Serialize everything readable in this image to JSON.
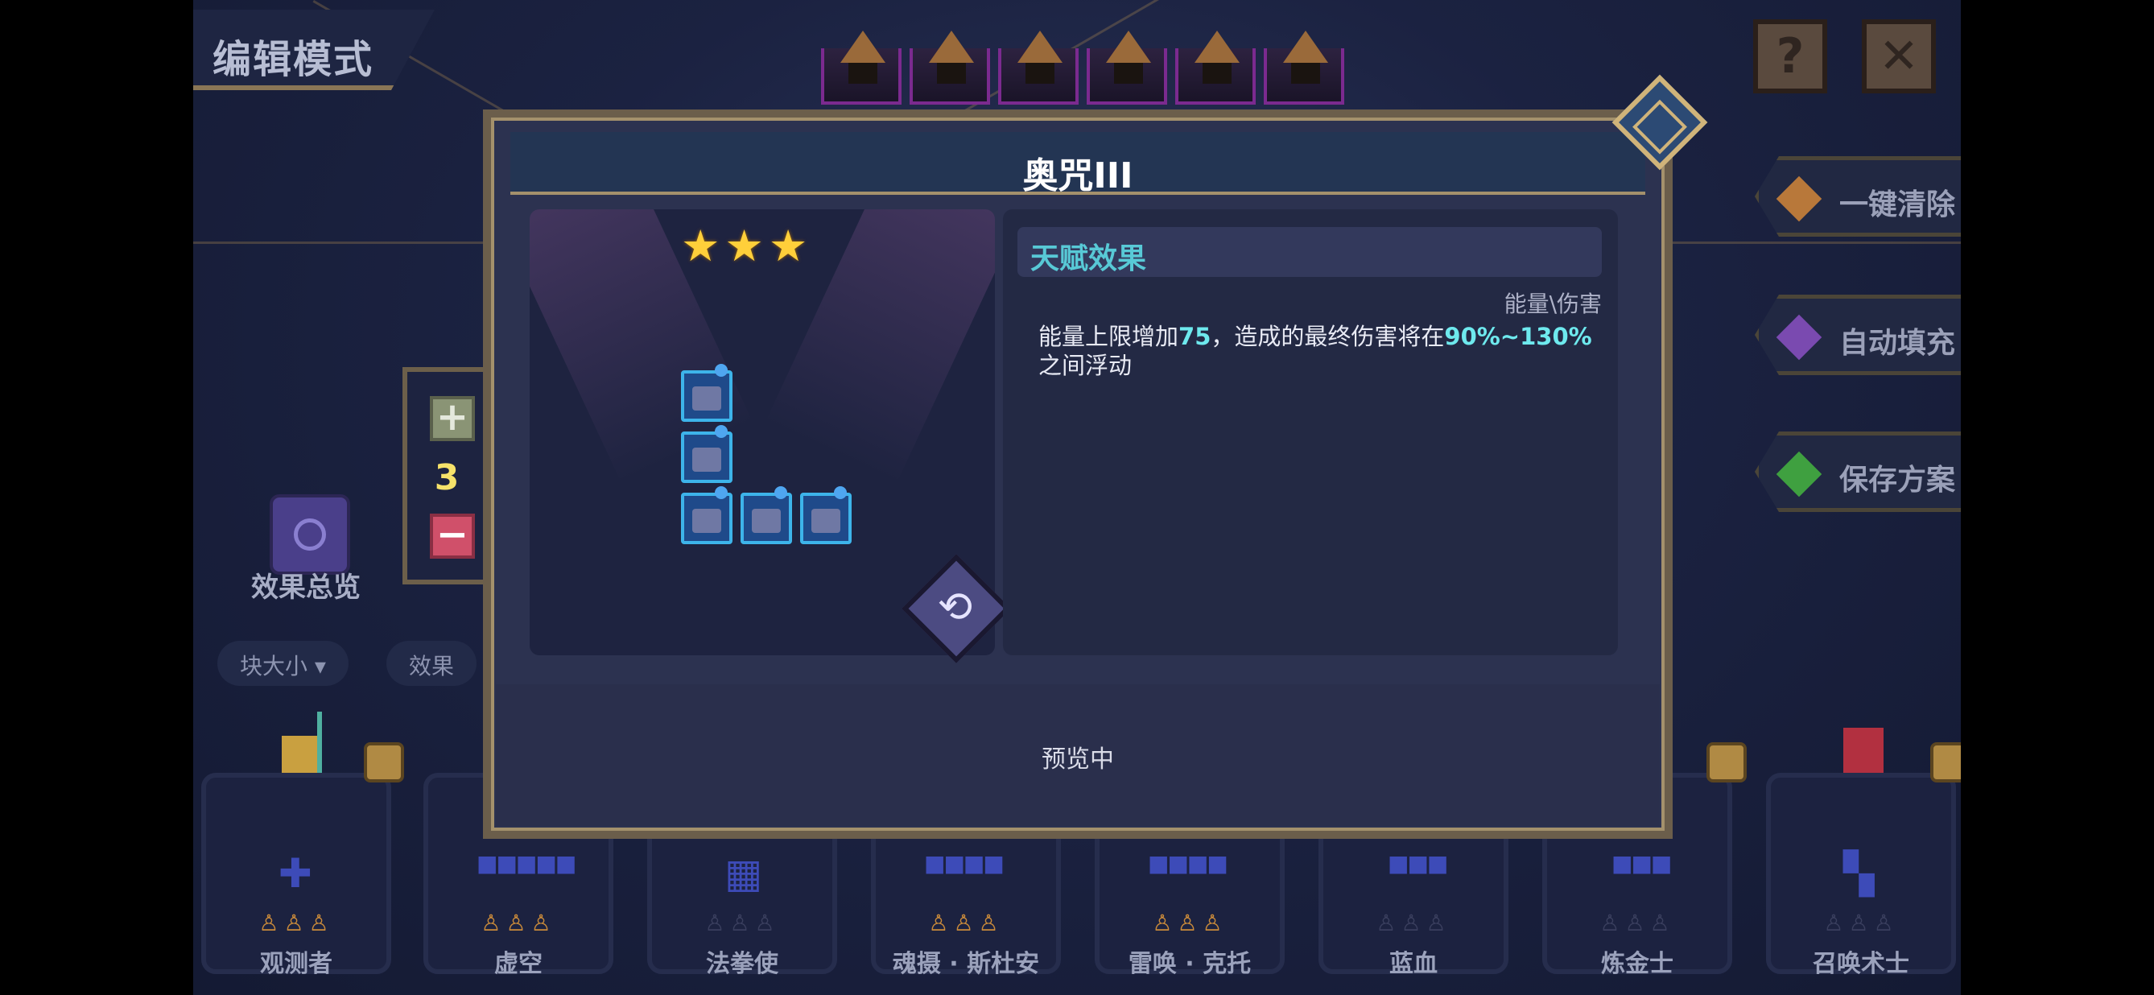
{
  "header": {
    "mode_title": "编辑模式"
  },
  "top_buttons": {
    "help": "?",
    "close": "✕"
  },
  "side_menu": [
    {
      "label": "一键清除",
      "color": "#b8783a"
    },
    {
      "label": "自动填充",
      "color": "#7a4ab0"
    },
    {
      "label": "保存方案",
      "color": "#3fa040"
    }
  ],
  "count_panel": {
    "plus": "+",
    "count": "3",
    "minus": "−"
  },
  "overview": {
    "label": "效果总览"
  },
  "filters": {
    "size": "块大小 ▾",
    "effect": "效果"
  },
  "modal": {
    "title": "奥咒III",
    "stars": "★★★",
    "talent_title": "天赋效果",
    "talent_tags": "能量\\伤害",
    "desc_part1": "能量上限增加",
    "desc_val1": "75",
    "desc_part2": "，造成的最终伤害将在",
    "desc_val2": "90%~130%",
    "desc_part3": "之间浮动",
    "status": "预览中",
    "rotate_icon": "⟲"
  },
  "cards": [
    {
      "name": "观测者",
      "shape": "✚",
      "stars": "♙♙♙",
      "star_color": "#c98a3a"
    },
    {
      "name": "虚空",
      "shape": "■■■■■",
      "stars": "♙♙♙",
      "star_color": "#c98a3a"
    },
    {
      "name": "法拳使",
      "shape": "▦",
      "stars": "♙♙♙",
      "star_color": "#3a3f5e"
    },
    {
      "name": "魂摄 · 斯杜安",
      "shape": "■■■■",
      "stars": "♙♙♙",
      "star_color": "#c98a3a"
    },
    {
      "name": "雷唤 · 克托",
      "shape": "■■■■",
      "stars": "♙♙♙",
      "star_color": "#c98a3a"
    },
    {
      "name": "蓝血",
      "shape": "■■■",
      "stars": "♙♙♙",
      "star_color": "#3a3f5e"
    },
    {
      "name": "炼金士",
      "shape": "■■■",
      "stars": "♙♙♙",
      "star_color": "#3a3f5e"
    },
    {
      "name": "召唤术士",
      "shape": "▚",
      "stars": "♙♙♙",
      "star_color": "#3a3f5e"
    }
  ]
}
